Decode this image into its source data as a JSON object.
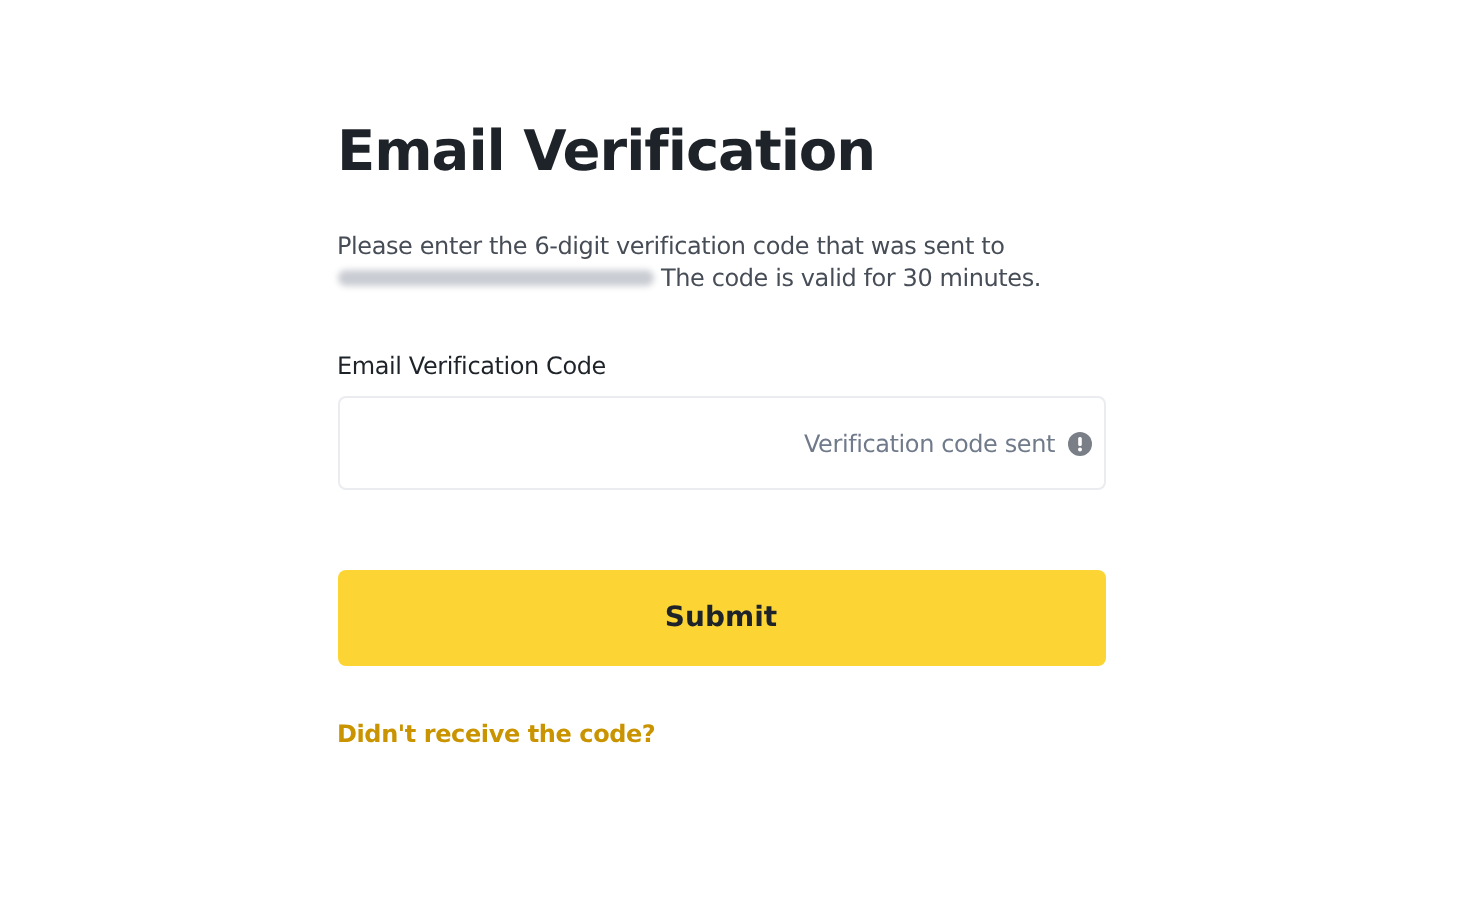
{
  "title": "Email Verification",
  "description": {
    "before": "Please enter the 6-digit verification code that was sent to",
    "email_redacted": true,
    "after": "The code is valid for 30 minutes."
  },
  "field": {
    "label": "Email Verification Code",
    "status": "Verification code sent"
  },
  "submit_button": "Submit",
  "resend_link": "Didn't receive the code?"
}
